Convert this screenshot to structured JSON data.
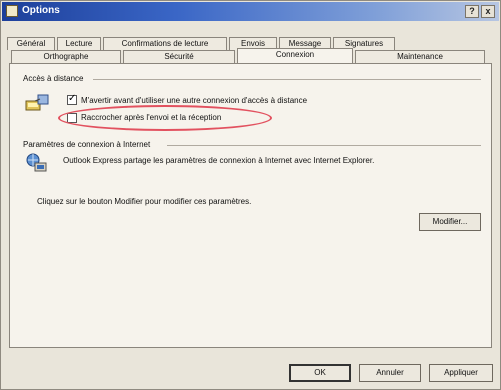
{
  "window": {
    "title": "Options",
    "help": "?",
    "close": "x"
  },
  "tabs_back": [
    "Général",
    "Lecture",
    "Confirmations de lecture",
    "Envois",
    "Message",
    "Signatures"
  ],
  "tabs_front": [
    "Orthographe",
    "Sécurité",
    "Connexion",
    "Maintenance"
  ],
  "active_tab": "Connexion",
  "dialup": {
    "group_label": "Accès à distance",
    "option1": {
      "label": "M'avertir avant d'utiliser une autre connexion d'accès à distance",
      "checked": true
    },
    "option2": {
      "label": "Raccrocher après l'envoi et la réception",
      "checked": false
    }
  },
  "internet": {
    "group_label": "Paramètres de connexion à Internet",
    "info": "Outlook Express partage les paramètres de connexion à Internet avec Internet Explorer.",
    "hint": "Cliquez sur le bouton Modifier pour modifier ces paramètres.",
    "modify_button": "Modifier..."
  },
  "footer": {
    "ok": "OK",
    "cancel": "Annuler",
    "apply": "Appliquer"
  }
}
